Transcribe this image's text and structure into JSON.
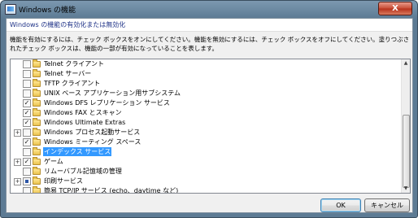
{
  "window": {
    "title": "Windows の機能",
    "close_label": "X"
  },
  "heading": "Windows の機能の有効化または無効化",
  "description": "機能を有効にするには、チェック ボックスをオンにしてください。機能を無効にするには、チェック ボックスをオフにしてください。塗りつぶされたチェック ボックスは、機能の一部が有効になっていることを表します。",
  "features": [
    {
      "label": "Telnet クライアント",
      "state": "unchecked",
      "expandable": false
    },
    {
      "label": "Telnet サーバー",
      "state": "unchecked",
      "expandable": false
    },
    {
      "label": "TFTP クライアント",
      "state": "unchecked",
      "expandable": false
    },
    {
      "label": "UNIX ベース アプリケーション用サブシステム",
      "state": "unchecked",
      "expandable": false
    },
    {
      "label": "Windows DFS レプリケーション サービス",
      "state": "checked",
      "expandable": false
    },
    {
      "label": "Windows FAX とスキャン",
      "state": "checked",
      "expandable": false
    },
    {
      "label": "Windows Ultimate Extras",
      "state": "checked",
      "expandable": false
    },
    {
      "label": "Windows プロセス起動サービス",
      "state": "unchecked",
      "expandable": true
    },
    {
      "label": "Windows ミーティング スペース",
      "state": "checked",
      "expandable": false
    },
    {
      "label": "インデックス サービス",
      "state": "unchecked",
      "expandable": false,
      "selected": true
    },
    {
      "label": "ゲーム",
      "state": "checked",
      "expandable": true
    },
    {
      "label": "リムーバブル記憶域の管理",
      "state": "unchecked",
      "expandable": false
    },
    {
      "label": "印刷サービス",
      "state": "partial",
      "expandable": true
    },
    {
      "label": "簡易 TCP/IP サービス (echo、daytime など)",
      "state": "unchecked",
      "expandable": false
    }
  ],
  "buttons": {
    "ok": "OK",
    "cancel": "キャンセル"
  }
}
